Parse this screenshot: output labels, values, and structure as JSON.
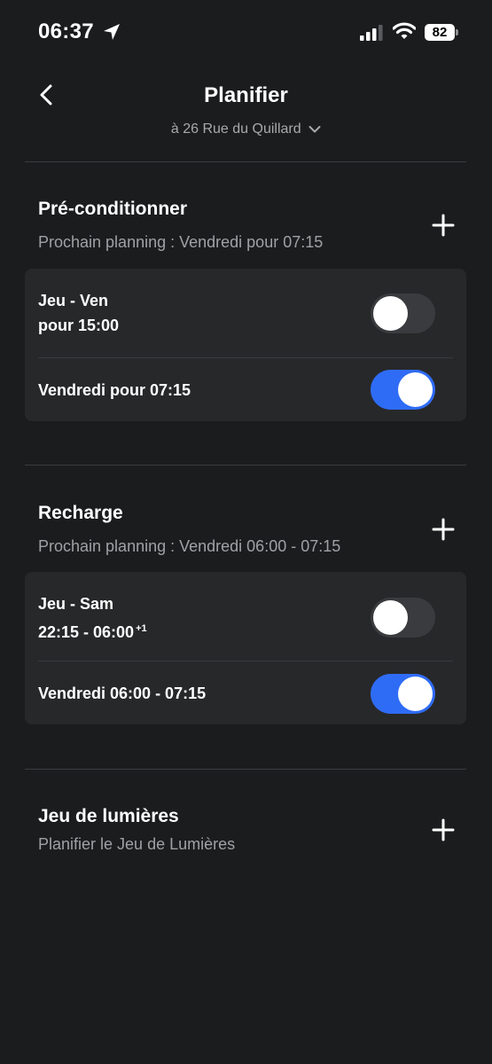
{
  "status_bar": {
    "time": "06:37",
    "battery": "82"
  },
  "header": {
    "title": "Planifier",
    "address": "à 26 Rue du Quillard"
  },
  "sections": {
    "precondition": {
      "title": "Pré-conditionner",
      "subtitle": "Prochain planning : Vendredi pour 07:15",
      "items": [
        {
          "line1": "Jeu - Ven",
          "line2": "pour 15:00",
          "enabled": false
        },
        {
          "line1": "Vendredi pour 07:15",
          "enabled": true
        }
      ]
    },
    "charge": {
      "title": "Recharge",
      "subtitle": "Prochain planning : Vendredi 06:00 - 07:15",
      "items": [
        {
          "line1": "Jeu - Sam",
          "line2": "22:15 - 06:00",
          "line2_sup": "+1",
          "enabled": false
        },
        {
          "line1": "Vendredi 06:00 - 07:15",
          "enabled": true
        }
      ]
    },
    "light_show": {
      "title": "Jeu de lumières",
      "subtitle": "Planifier le Jeu de Lumières"
    }
  },
  "colors": {
    "background": "#1b1c1e",
    "card": "#27282a",
    "toggle_on": "#2f6cf6",
    "toggle_off": "#3a3b3e",
    "secondary_text": "#a0a1a4"
  },
  "icons": {
    "back": "chevron-left-icon",
    "add": "plus-icon",
    "location": "location-arrow-icon",
    "signal": "signal-bars-icon",
    "wifi": "wifi-icon"
  }
}
